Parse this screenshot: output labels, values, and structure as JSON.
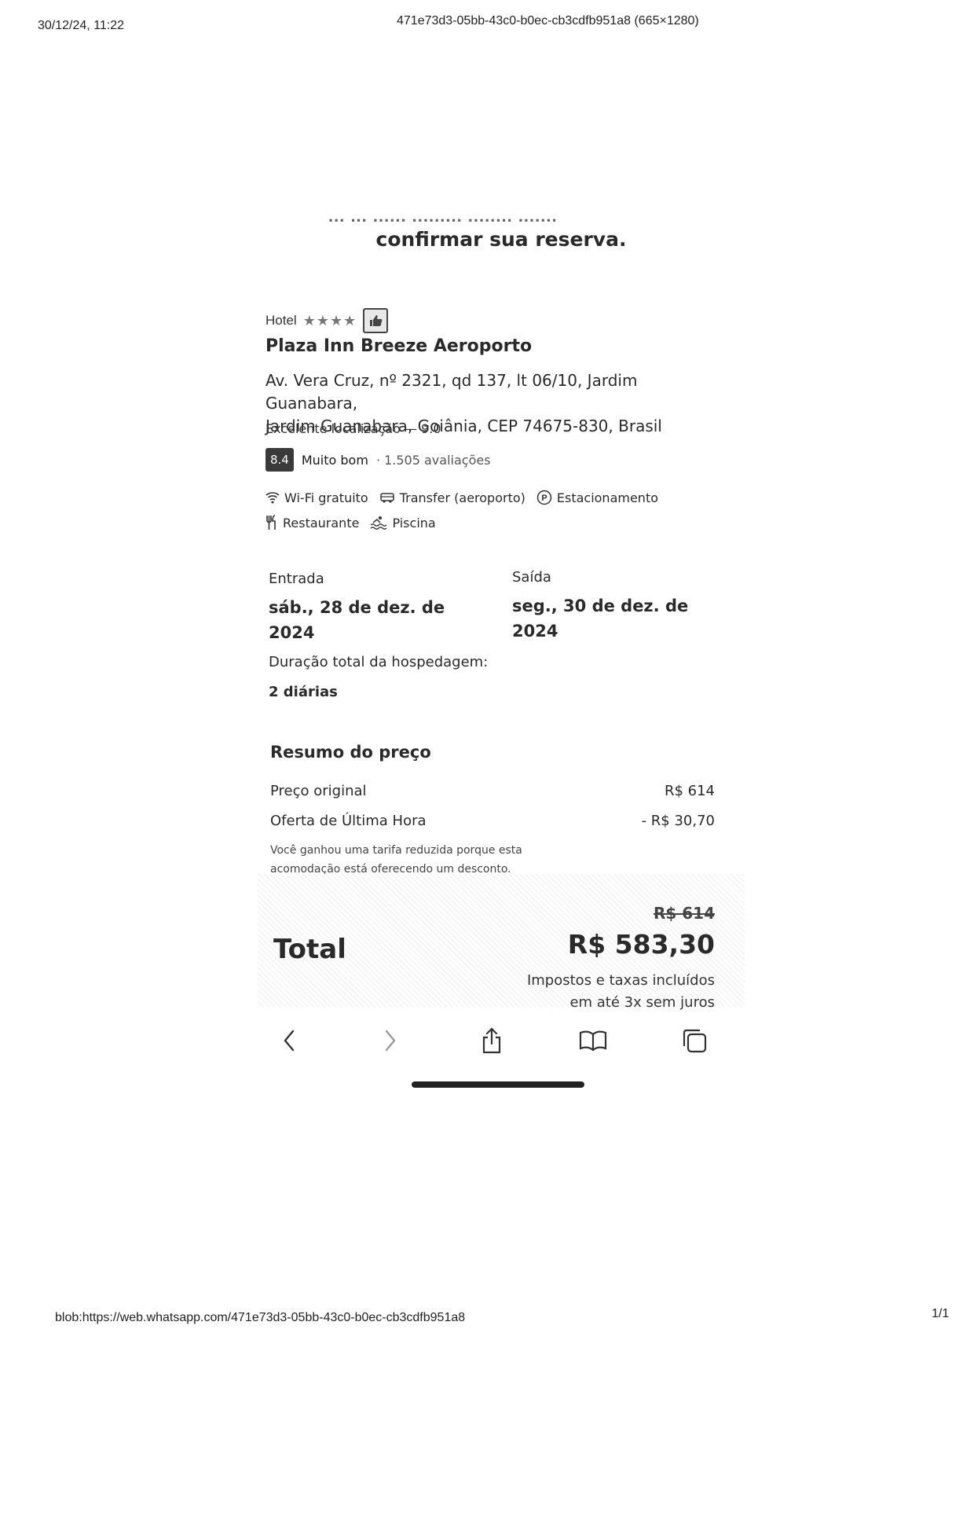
{
  "print": {
    "header_datetime": "30/12/24, 11:22",
    "header_title": "471e73d3-05bb-43c0-b0ec-cb3cdfb951a8 (665×1280)",
    "footer_url": "blob:https://web.whatsapp.com/471e73d3-05bb-43c0-b0ec-cb3cdfb951a8",
    "footer_page": "1/1"
  },
  "page": {
    "cut_line": "... ... ...... ......... ........ .......",
    "headline": "confirmar sua reserva."
  },
  "hotel": {
    "type_label": "Hotel",
    "stars": "★★★★",
    "name": "Plaza Inn Breeze Aeroporto",
    "address_line1": "Av. Vera Cruz, nº 2321, qd 137, lt 06/10, Jardim Guanabara,",
    "address_line2": "Jardim Guanabara, Goiânia, CEP 74675-830, Brasil",
    "location_score": "Excelente localização — 9.0",
    "score": "8.4",
    "score_label": "Muito bom",
    "reviews": "· 1.505 avaliações",
    "amenities": {
      "wifi": "Wi-Fi gratuito",
      "transfer": "Transfer (aeroporto)",
      "parking": "Estacionamento",
      "restaurant": "Restaurante",
      "pool": "Piscina"
    }
  },
  "stay": {
    "checkin_label": "Entrada",
    "checkin_line1": "sáb., 28 de dez. de",
    "checkin_line2": "2024",
    "checkout_label": "Saída",
    "checkout_line1": "seg., 30 de dez. de",
    "checkout_line2": "2024",
    "duration_label": "Duração total da hospedagem:",
    "duration_value": "2 diárias"
  },
  "price": {
    "title": "Resumo do preço",
    "original_label": "Preço original",
    "original_value": "R$ 614",
    "offer_label": "Oferta de Última Hora",
    "offer_value": "- R$ 30,70",
    "offer_note_line1": "Você ganhou uma tarifa reduzida porque esta",
    "offer_note_line2": "acomodação está oferecendo um desconto.",
    "old_total": "R$ 614",
    "total_label": "Total",
    "total_value": "R$ 583,30",
    "taxes_note": "Impostos e taxas incluídos",
    "installments_note": "em até 3x sem juros"
  },
  "toolbar": {
    "icons": [
      "back-icon",
      "forward-icon",
      "share-icon",
      "bookmarks-icon",
      "tabs-icon"
    ]
  }
}
